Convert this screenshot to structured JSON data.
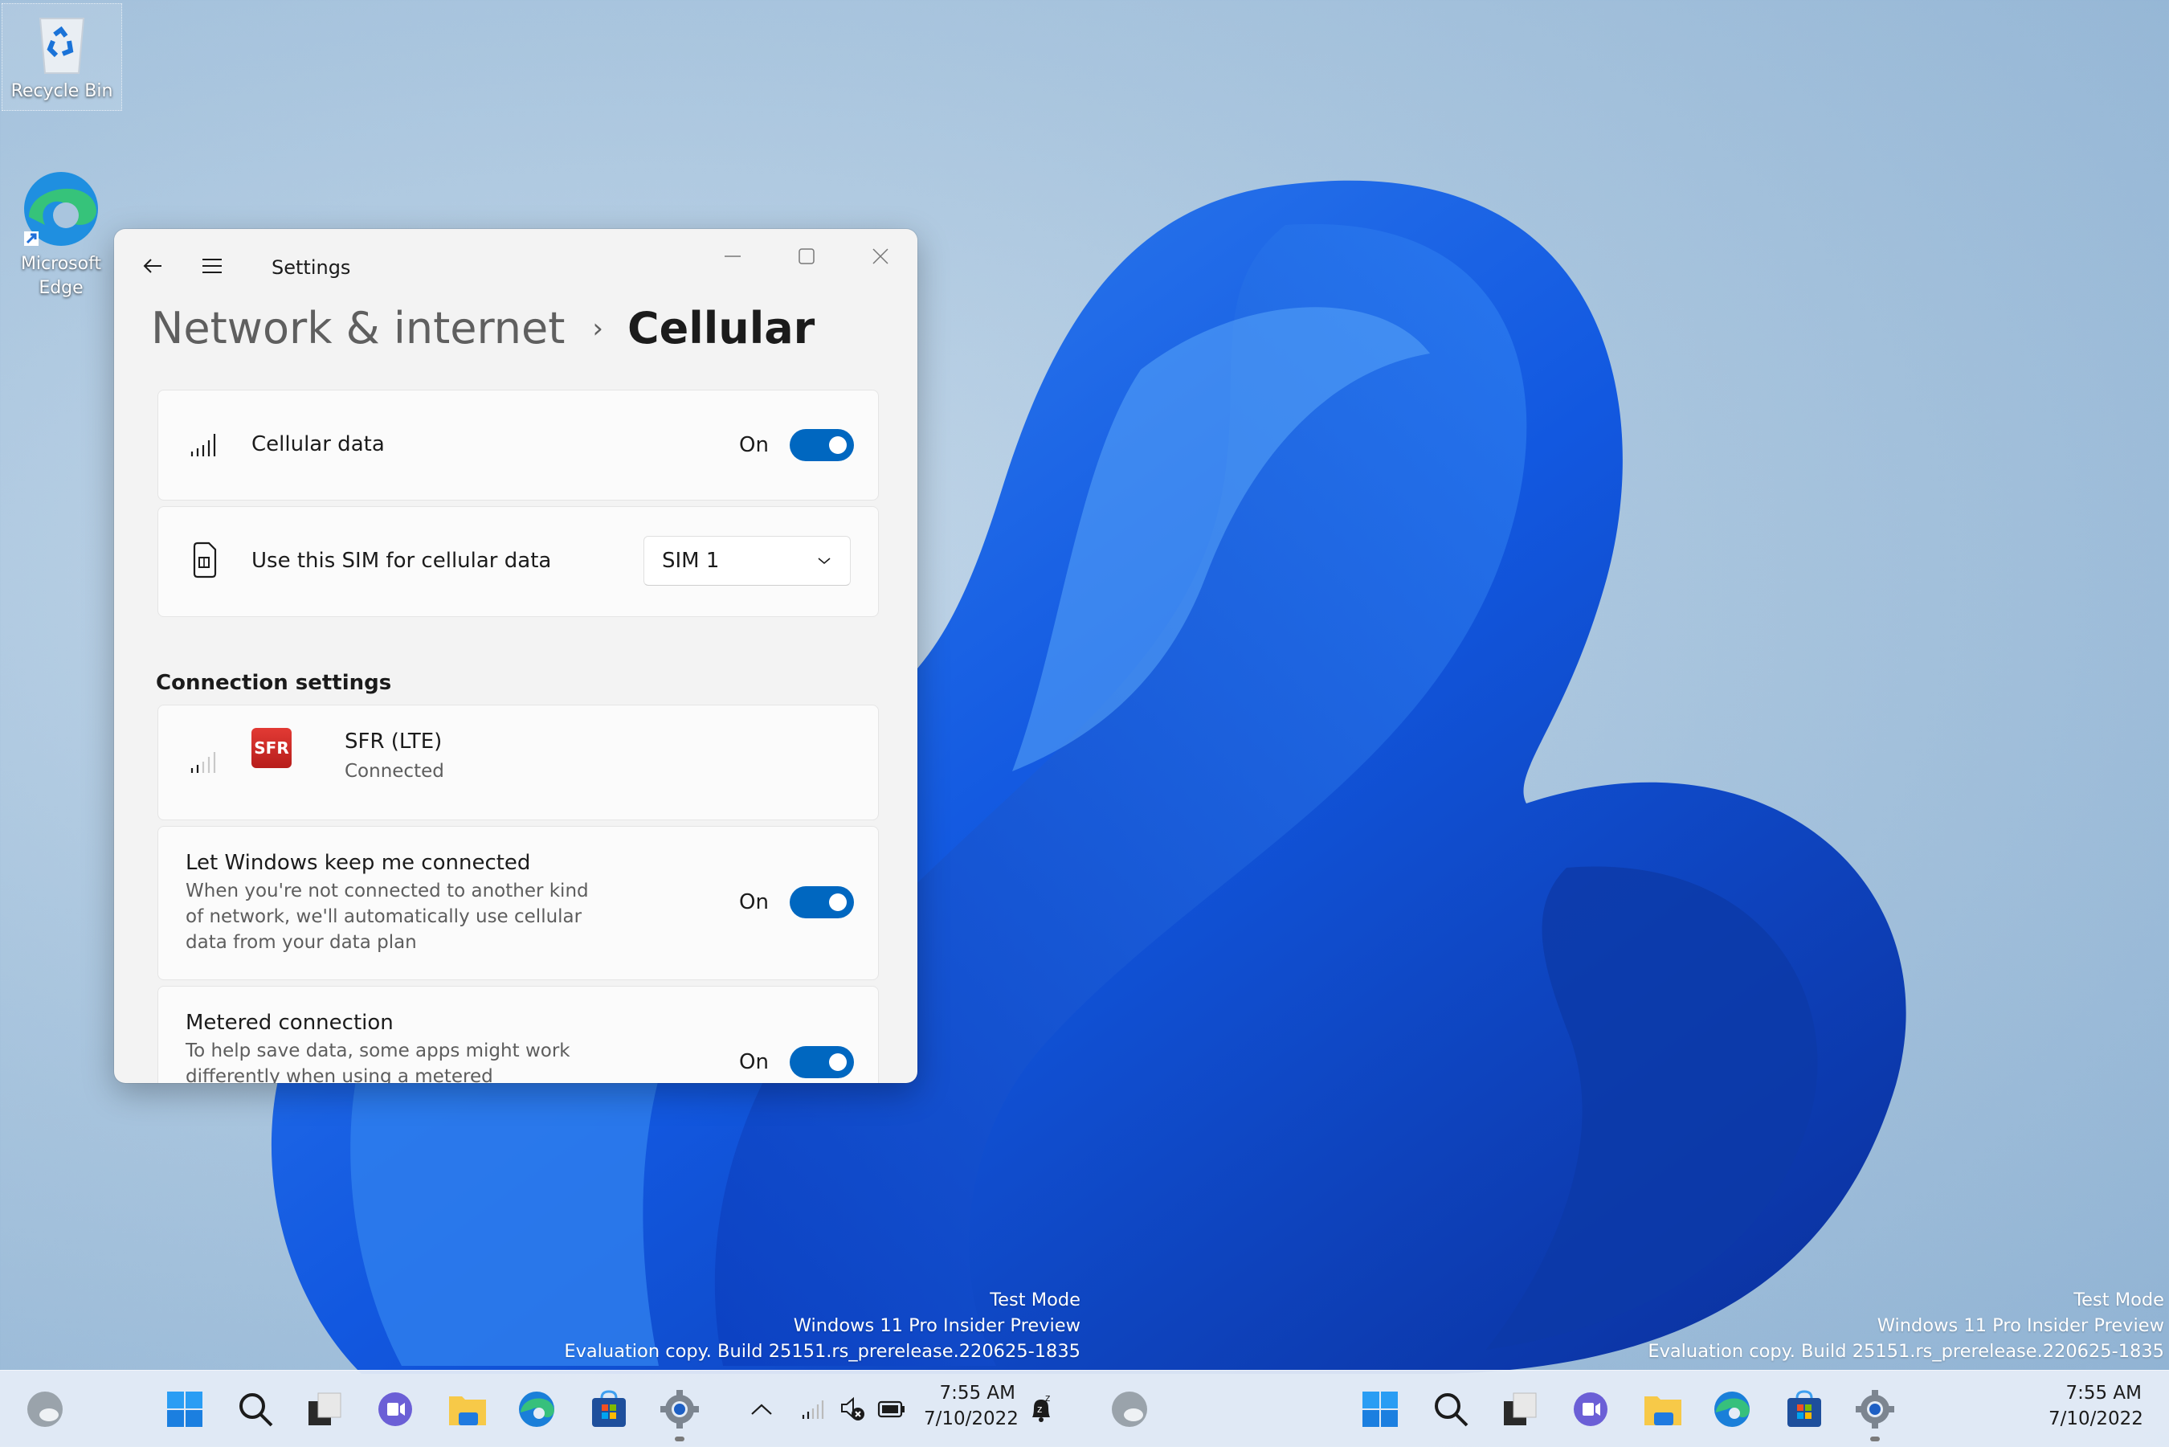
{
  "desktop": {
    "icons": [
      {
        "label": "Recycle Bin",
        "icon": "recycle-bin-icon"
      },
      {
        "label": "Microsoft Edge",
        "icon": "edge-icon"
      }
    ],
    "watermark": {
      "line1": "Test Mode",
      "line2": "Windows 11 Pro Insider Preview",
      "line3": "Evaluation copy. Build 25151.rs_prerelease.220625-1835"
    }
  },
  "window": {
    "app_title": "Settings",
    "controls": {
      "minimize": "minimize-icon",
      "maximize": "maximize-icon",
      "close": "close-icon"
    },
    "breadcrumb": {
      "parent": "Network & internet",
      "separator": "›",
      "current": "Cellular"
    },
    "cellular_data": {
      "label": "Cellular data",
      "state_text": "On",
      "enabled": true
    },
    "sim_select": {
      "label": "Use this SIM for cellular data",
      "selected": "SIM 1"
    },
    "connection_section": "Connection settings",
    "network": {
      "name": "SFR (LTE)",
      "status": "Connected",
      "carrier_logo_text": "SFR",
      "signal_bars": 2
    },
    "keep_connected": {
      "title": "Let Windows keep me connected",
      "desc_line1": "When you're not connected to another kind",
      "desc_line2": "of network, we'll automatically use cellular",
      "desc_line3": "data from your data plan",
      "state_text": "On",
      "enabled": true
    },
    "metered": {
      "title": "Metered connection",
      "desc_line1": "To help save data, some apps might work",
      "desc_line2": "differently when using a metered",
      "state_text": "On",
      "enabled": true
    }
  },
  "taskbar": {
    "left_group": [
      "weather-icon",
      "start-icon",
      "search-icon",
      "task-view-icon",
      "chat-icon",
      "file-explorer-icon",
      "edge-icon",
      "store-icon",
      "settings-icon"
    ],
    "tray": [
      "chevron-up-icon",
      "cellular-signal-icon",
      "volume-muted-icon",
      "battery-icon"
    ],
    "time": "7:55 AM",
    "date": "7/10/2022",
    "notification": "do-not-disturb-bell-icon",
    "right_group": [
      "weather-icon",
      "start-icon",
      "search-icon",
      "task-view-icon",
      "chat-icon",
      "file-explorer-icon",
      "edge-icon",
      "store-icon",
      "settings-icon"
    ],
    "time2": "7:55 AM",
    "date2": "7/10/2022"
  },
  "colors": {
    "accent": "#0067c0",
    "window_bg": "#f3f3f3",
    "card_bg": "#fbfbfb",
    "sfr_red": "#d42b27"
  }
}
